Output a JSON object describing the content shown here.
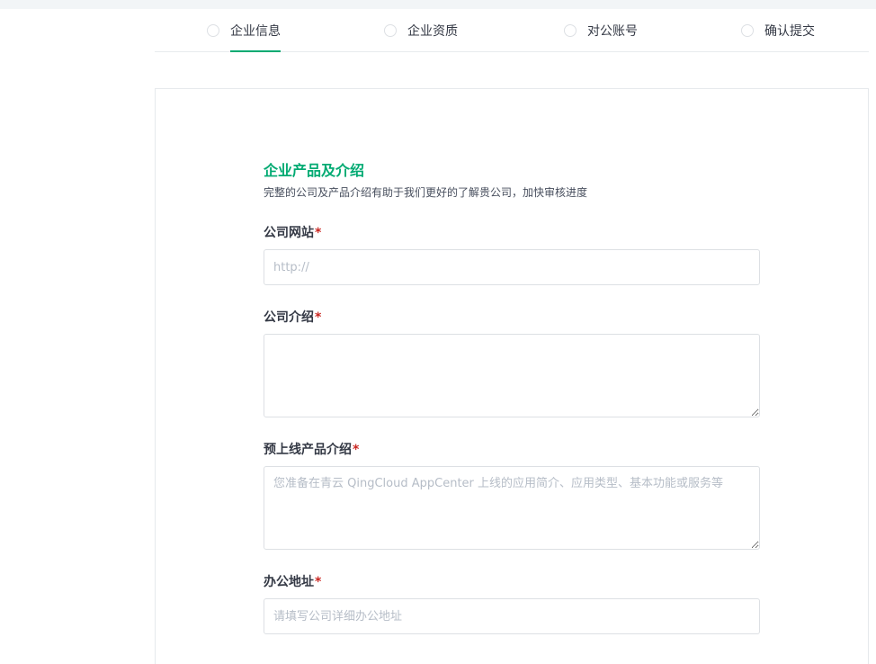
{
  "steps": [
    {
      "label": "企业信息",
      "active": true
    },
    {
      "label": "企业资质",
      "active": false
    },
    {
      "label": "对公账号",
      "active": false
    },
    {
      "label": "确认提交",
      "active": false
    }
  ],
  "form": {
    "section_title": "企业产品及介绍",
    "section_desc": "完整的公司及产品介绍有助于我们更好的了解贵公司，加快审核进度",
    "required_mark": "*",
    "website": {
      "label": "公司网站",
      "placeholder": "http://",
      "value": ""
    },
    "intro": {
      "label": "公司介绍",
      "placeholder": "",
      "value": ""
    },
    "product_intro": {
      "label": "预上线产品介绍",
      "placeholder": "您准备在青云 QingCloud AppCenter 上线的应用简介、应用类型、基本功能或服务等",
      "value": ""
    },
    "address": {
      "label": "办公地址",
      "placeholder": "请填写公司详细办公地址",
      "value": ""
    }
  },
  "colors": {
    "accent": "#00aa72",
    "required": "#ca2621",
    "border": "#dde0e4"
  }
}
